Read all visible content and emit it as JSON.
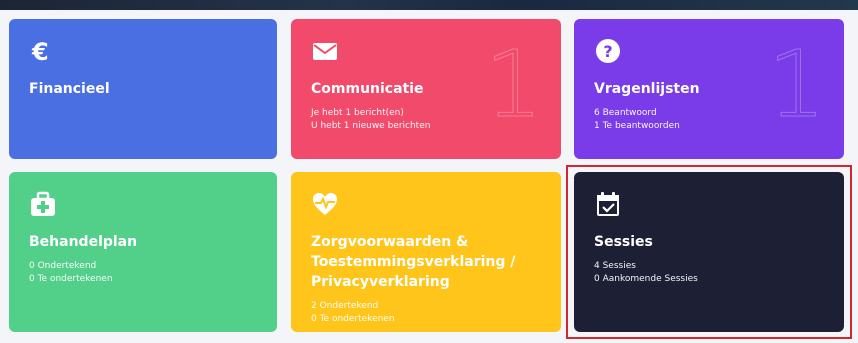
{
  "cards": {
    "financieel": {
      "title": "Financieel",
      "icon": "euro-icon"
    },
    "communicatie": {
      "title": "Communicatie",
      "icon": "envelope-icon",
      "lines": [
        "Je hebt 1 bericht(en)",
        "U hebt 1 nieuwe berichten"
      ],
      "count": "1"
    },
    "vragenlijsten": {
      "title": "Vragenlijsten",
      "icon": "question-circle-icon",
      "lines": [
        "6 Beantwoord",
        "1 Te beantwoorden"
      ],
      "count": "1"
    },
    "behandelplan": {
      "title": "Behandelplan",
      "icon": "medical-kit-icon",
      "lines": [
        "0 Ondertekend",
        "0 Te ondertekenen"
      ]
    },
    "zorgvoorwaarden": {
      "title": "Zorgvoorwaarden & Toestemmingsverklaring / Privacyverklaring",
      "icon": "heartbeat-icon",
      "lines": [
        "2 Ondertekend",
        "0 Te ondertekenen"
      ]
    },
    "sessies": {
      "title": "Sessies",
      "icon": "calendar-check-icon",
      "lines": [
        "4 Sessies",
        "0 Aankomende Sessies"
      ]
    }
  },
  "colors": {
    "financieel": "#4a6fe3",
    "communicatie": "#f14a6b",
    "vragenlijsten": "#7a3be8",
    "behandelplan": "#52d08a",
    "zorgvoorwaarden": "#ffc51a",
    "sessies": "#1d1f35",
    "highlight": "#d3262d"
  }
}
